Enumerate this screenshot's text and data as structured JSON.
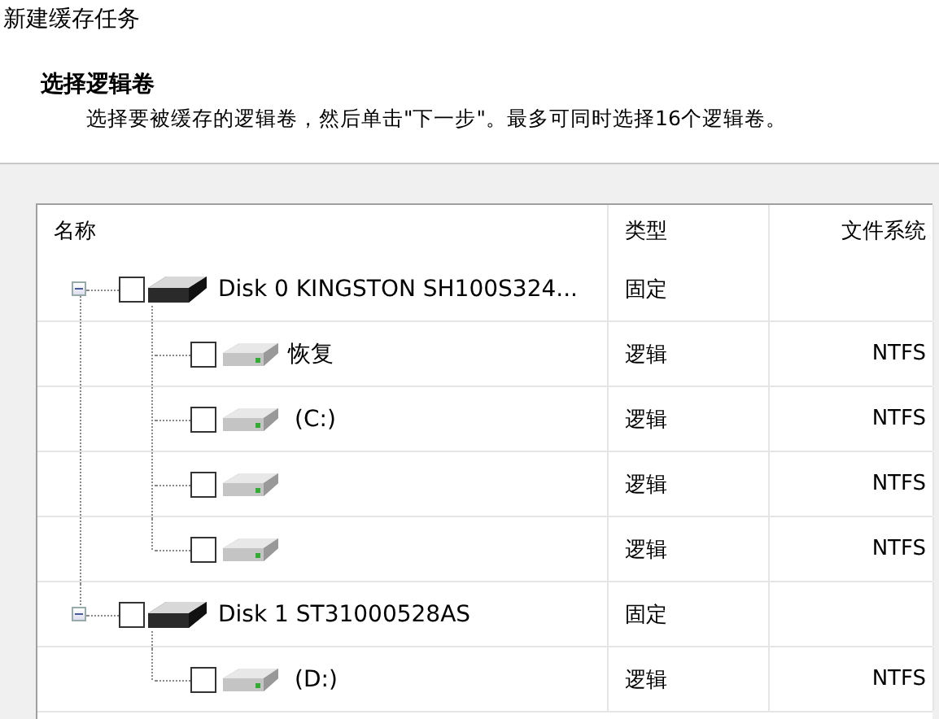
{
  "window": {
    "title": "新建缓存任务"
  },
  "header": {
    "title": "选择逻辑卷",
    "description": "选择要被缓存的逻辑卷，然后单击\"下一步\"。最多可同时选择16个逻辑卷。"
  },
  "table": {
    "columns": [
      "名称",
      "类型",
      "文件系统"
    ],
    "disks": [
      {
        "name": "Disk 0 KINGSTON SH100S324...",
        "type": "固定",
        "expanded": true,
        "checked": false,
        "children": [
          {
            "name": "恢复",
            "type": "逻辑",
            "filesystem": "NTFS",
            "checked": false
          },
          {
            "name": "(C:)",
            "type": "逻辑",
            "filesystem": "NTFS",
            "checked": false
          },
          {
            "type": "逻辑",
            "filesystem": "NTFS",
            "checked": false
          },
          {
            "type": "逻辑",
            "filesystem": "NTFS",
            "checked": false
          }
        ]
      },
      {
        "name": "Disk 1 ST31000528AS",
        "type": "固定",
        "expanded": true,
        "checked": false,
        "children": [
          {
            "name": "(D:)",
            "type": "逻辑",
            "filesystem": "NTFS",
            "checked": false
          }
        ]
      }
    ]
  }
}
